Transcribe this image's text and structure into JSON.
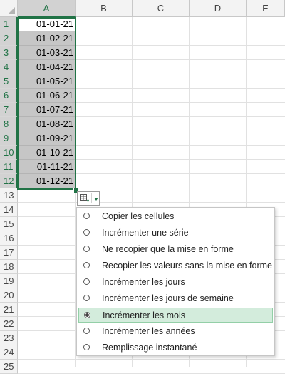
{
  "columns": [
    "A",
    "B",
    "C",
    "D",
    "E"
  ],
  "rows": [
    "1",
    "2",
    "3",
    "4",
    "5",
    "6",
    "7",
    "8",
    "9",
    "10",
    "11",
    "12",
    "13",
    "14",
    "15",
    "16",
    "17",
    "18",
    "19",
    "20",
    "21",
    "22",
    "23",
    "24",
    "25"
  ],
  "cells_A": [
    "01-01-21",
    "01-02-21",
    "01-03-21",
    "01-04-21",
    "01-05-21",
    "01-06-21",
    "01-07-21",
    "01-08-21",
    "01-09-21",
    "01-10-21",
    "01-11-21",
    "01-12-21"
  ],
  "selected_column": "A",
  "selected_rows": "1-12",
  "autofill_button": {
    "icon": "auto-fill-options-icon",
    "dropdown_icon": "chevron-down-icon"
  },
  "autofill_menu": {
    "items": [
      {
        "label": "Copier les cellules",
        "checked": false
      },
      {
        "label": "Incrémenter une série",
        "checked": false
      },
      {
        "label": "Ne recopier que la mise en forme",
        "checked": false
      },
      {
        "label": "Recopier les valeurs sans la mise en forme",
        "checked": false
      },
      {
        "label": "Incrémenter les jours",
        "checked": false
      },
      {
        "label": "Incrémenter les jours de semaine",
        "checked": false
      },
      {
        "label": "Incrémenter les mois",
        "checked": true
      },
      {
        "label": "Incrémenter les années",
        "checked": false
      },
      {
        "label": "Remplissage instantané",
        "checked": false
      }
    ]
  },
  "colors": {
    "excel_green": "#217346",
    "selected_fill": "#c6c6c6",
    "menu_highlight": "#d3ecdc"
  }
}
